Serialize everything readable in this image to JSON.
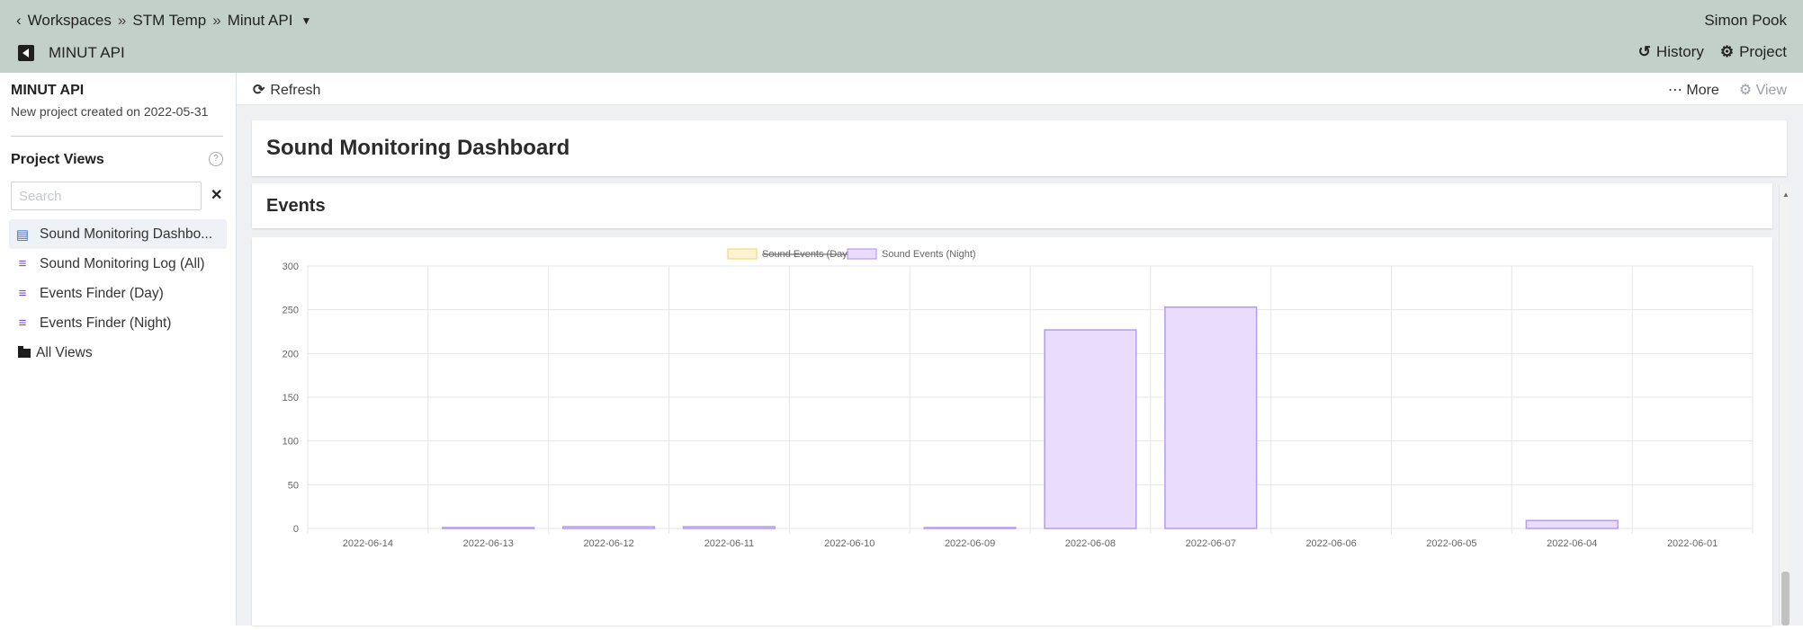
{
  "header": {
    "breadcrumbs": [
      {
        "label": "Workspaces"
      },
      {
        "label": "STM Temp"
      },
      {
        "label": "Minut API"
      }
    ],
    "separator": "»",
    "user": "Simon Pook",
    "project_name": "MINUT API",
    "history_label": "History",
    "project_label": "Project"
  },
  "sidebar": {
    "title": "MINUT API",
    "subtitle": "New project created on 2022-05-31",
    "views_heading": "Project Views",
    "search_placeholder": "Search",
    "items": [
      {
        "label": "Sound Monitoring Dashbo...",
        "icon": "bar-chart-icon",
        "active": true
      },
      {
        "label": "Sound Monitoring Log (All)",
        "icon": "list-icon"
      },
      {
        "label": "Events Finder (Day)",
        "icon": "list-icon"
      },
      {
        "label": "Events Finder (Night)",
        "icon": "list-icon"
      }
    ],
    "all_views_label": "All Views"
  },
  "toolbar": {
    "refresh_label": "Refresh",
    "more_label": "More",
    "view_label": "View"
  },
  "main": {
    "dashboard_title": "Sound Monitoring Dashboard",
    "section_title": "Events"
  },
  "chart_data": {
    "type": "bar",
    "categories": [
      "2022-06-14",
      "2022-06-13",
      "2022-06-12",
      "2022-06-11",
      "2022-06-10",
      "2022-06-09",
      "2022-06-08",
      "2022-06-07",
      "2022-06-06",
      "2022-06-05",
      "2022-06-04",
      "2022-06-01"
    ],
    "series": [
      {
        "name": "Sound Events (Day)",
        "hidden": true,
        "color": "#f7d774",
        "values": []
      },
      {
        "name": "Sound Events (Night)",
        "color": "#b49cf2",
        "values": [
          0,
          1,
          2,
          2,
          0,
          1,
          227,
          253,
          0,
          0,
          9,
          0
        ]
      }
    ],
    "ylim": [
      0,
      300
    ],
    "yticks": [
      0,
      50,
      100,
      150,
      200,
      250,
      300
    ],
    "grid": true,
    "legend": "top-center"
  }
}
